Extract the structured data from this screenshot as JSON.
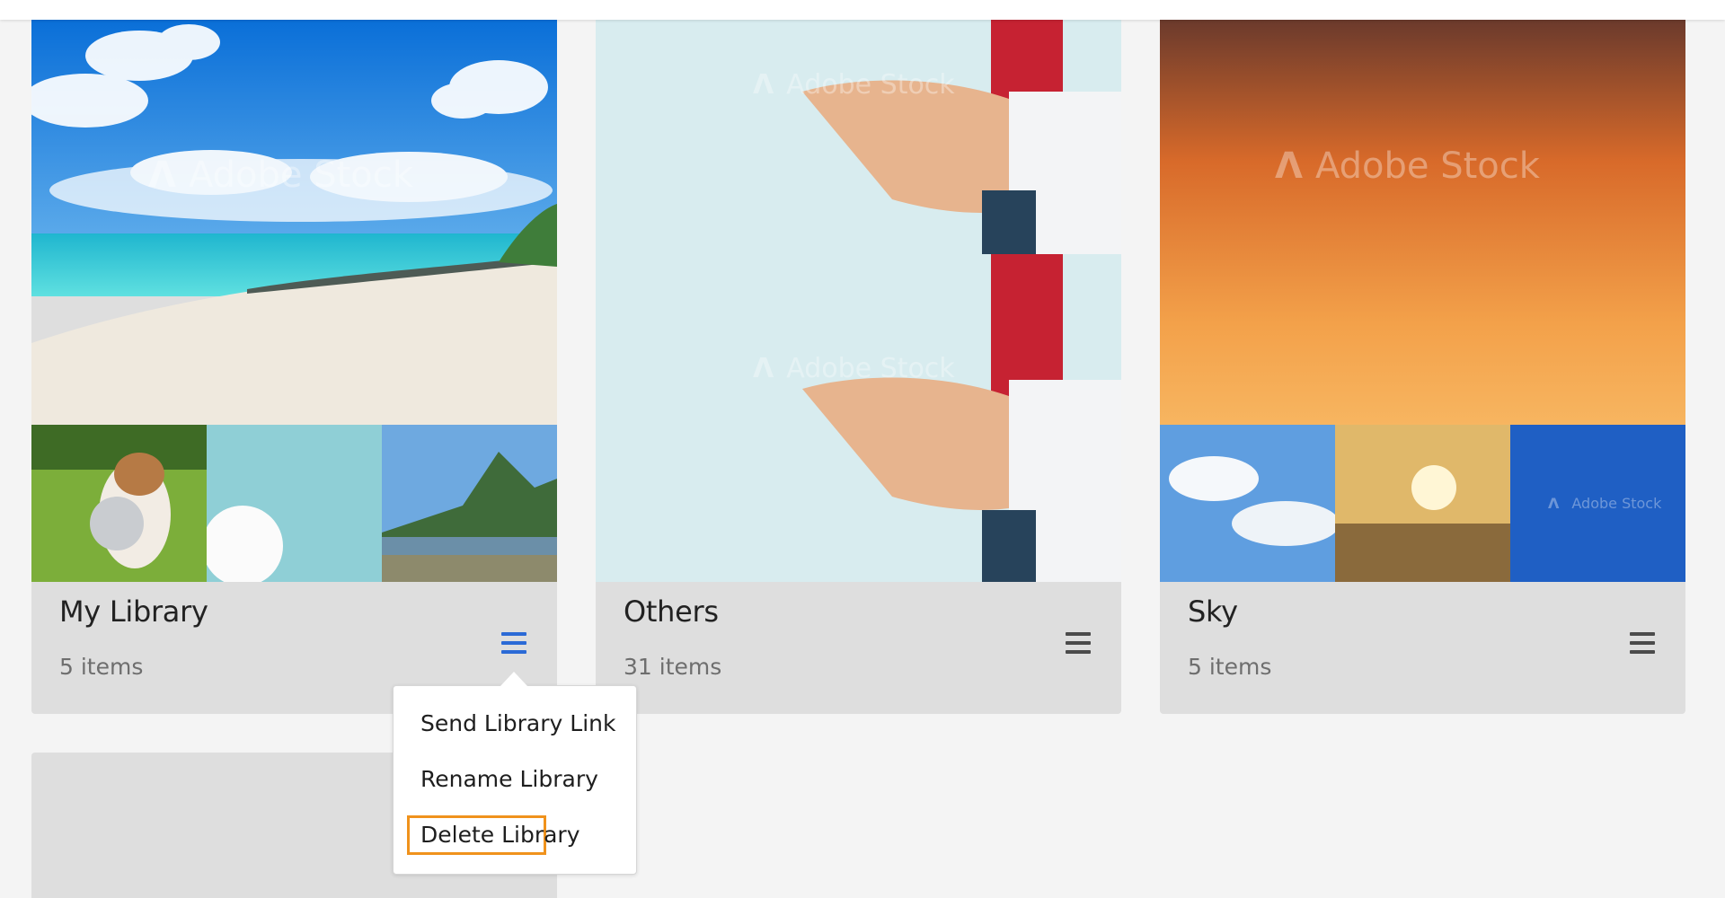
{
  "watermark": "Adobe Stock",
  "accent_color": "#2b6ad6",
  "highlight_color": "#f0921c",
  "libraries": [
    {
      "title": "My Library",
      "count": "5 items",
      "menu_active": true,
      "hero_image": "tropical beach with turquoise water and clouds",
      "thumbnails": [
        "terrier dog carrying metal bowl on grass",
        "white samoyed dog on teal background",
        "misty mountain lake with rocks"
      ]
    },
    {
      "title": "Others",
      "count": "31 items",
      "menu_active": false,
      "hero_image": "hand pointing at glass touch screen",
      "thumbnails": [
        "hand pointing at glass touch screen"
      ]
    },
    {
      "title": "Sky",
      "count": "5 items",
      "menu_active": false,
      "hero_image": "orange sunset sky with clouds",
      "thumbnails": [
        "blue sky with white clouds",
        "sun above clouds",
        "deep blue sky"
      ]
    }
  ],
  "context_menu": {
    "items": [
      "Send Library Link",
      "Rename Library",
      "Delete Library"
    ],
    "highlighted_item": "Delete Library"
  }
}
